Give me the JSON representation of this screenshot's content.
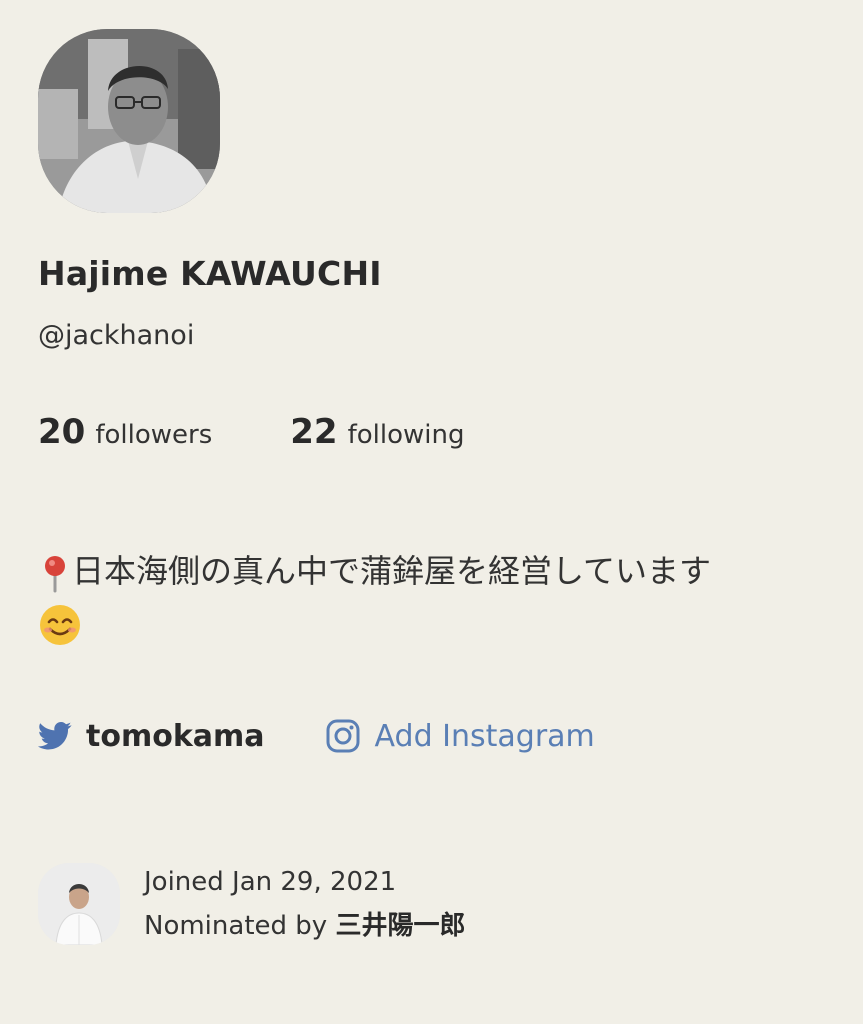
{
  "profile": {
    "name": "Hajime KAWAUCHI",
    "handle": "@jackhanoi"
  },
  "stats": {
    "followers_count": "20",
    "followers_label": "followers",
    "following_count": "22",
    "following_label": "following"
  },
  "bio": {
    "line1": "日本海側の真ん中で蒲鉾屋を経営しています",
    "pin_icon": "round-pushpin-icon",
    "smile_icon": "smiling-face-icon"
  },
  "socials": {
    "twitter_username": "tomokama",
    "twitter_icon": "twitter-bird-icon",
    "instagram_label": "Add Instagram",
    "instagram_icon": "instagram-icon",
    "instagram_color": "#5a7fb5"
  },
  "joined": {
    "joined_text": "Joined Jan 29, 2021",
    "nominated_prefix": "Nominated by ",
    "nominated_name": "三井陽一郎"
  },
  "colors": {
    "background": "#f1efe7",
    "twitter_icon": "#4f73b0",
    "text": "#2b2b2b"
  }
}
